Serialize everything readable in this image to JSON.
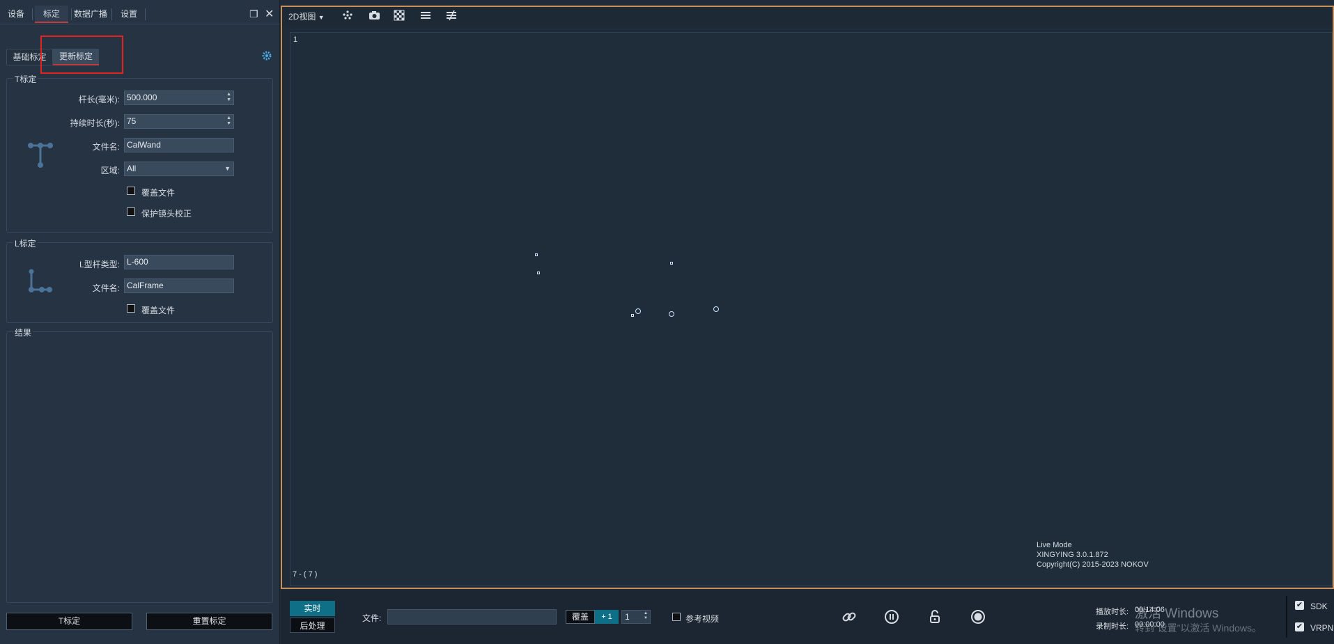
{
  "top_tabs": [
    "设备",
    "标定",
    "数据广播",
    "设置"
  ],
  "sub_tabs": [
    "基础标定",
    "更新标定"
  ],
  "t_cal": {
    "title": "T标定",
    "rod_length_label": "杆长(毫米):",
    "rod_length": "500.000",
    "duration_label": "持续时长(秒):",
    "duration": "75",
    "filename_label": "文件名:",
    "filename": "CalWand",
    "region_label": "区域:",
    "region": "All",
    "overwrite": "覆盖文件",
    "protect_lens": "保护镜头校正"
  },
  "l_cal": {
    "title": "L标定",
    "type_label": "L型杆类型:",
    "type": "L-600",
    "filename_label": "文件名:",
    "filename": "CalFrame",
    "overwrite": "覆盖文件"
  },
  "result_title": "结果",
  "buttons": {
    "t_cal": "T标定",
    "reset_cal": "重置标定"
  },
  "viewport": {
    "view_mode": "2D视图",
    "camera_index": "1",
    "marker_count": "7 - ( 7 )",
    "mode_text": "Live Mode",
    "version": "XINGYING 3.0.1.872",
    "copyright": "Copyright(C) 2015-2023 NOKOV"
  },
  "bottom": {
    "realtime": "实时",
    "postprocess": "后处理",
    "file_label": "文件:",
    "overwrite_btn": "覆盖",
    "plus_one": "+ 1",
    "step_value": "1",
    "ref_video": "参考视频",
    "play_time_label": "播放时长:",
    "play_time": "00:14:06",
    "rec_time_label": "录制时长:",
    "rec_time": "00:00:00",
    "sdk": "SDK",
    "vrpn": "VRPN",
    "watermark_1": "激活 Windows",
    "watermark_2": "转到“设置”以激活 Windows。"
  },
  "colors": {
    "accent_red": "#c23b3b",
    "viewport_border": "#c89058",
    "teal": "#0e6f86"
  }
}
